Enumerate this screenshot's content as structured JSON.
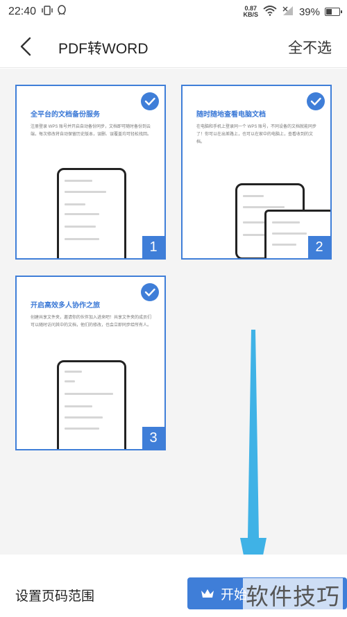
{
  "status_bar": {
    "time": "22:40",
    "net_speed_value": "0.87",
    "net_speed_unit": "KB/S",
    "battery": "39%",
    "battery_level": 0.39
  },
  "header": {
    "title": "PDF转WORD",
    "deselect_all": "全不选"
  },
  "pages": [
    {
      "number": "1",
      "heading": "全平台的文档备份服务",
      "body": "注册登录 WPS 账号并开启自动备份同步，文档即可随时备份到云端，每次修改将自动保留历史版本，误删、误覆盖均可轻松找回。"
    },
    {
      "number": "2",
      "heading": "随时随地查看电脑文档",
      "body": "在电脑和手机上登录同一个 WPS 账号，不同设备的文档就能同步了！你可以在出差路上，也可以在家中的电脑上，查看收到的文档。"
    },
    {
      "number": "3",
      "heading": "开启高效多人协作之旅",
      "body": "创建共享文件夹，邀请你的伙伴加入进来吧！共享文件夹的成员们可以随时访问其中的文档，他们的修改，也会立即同步给所有人。"
    }
  ],
  "footer": {
    "page_range": "设置页码范围",
    "start_button": "开始",
    "watermark": "软件技巧"
  },
  "colors": {
    "accent": "#3f7ed8",
    "arrow": "#3fb2e6"
  }
}
